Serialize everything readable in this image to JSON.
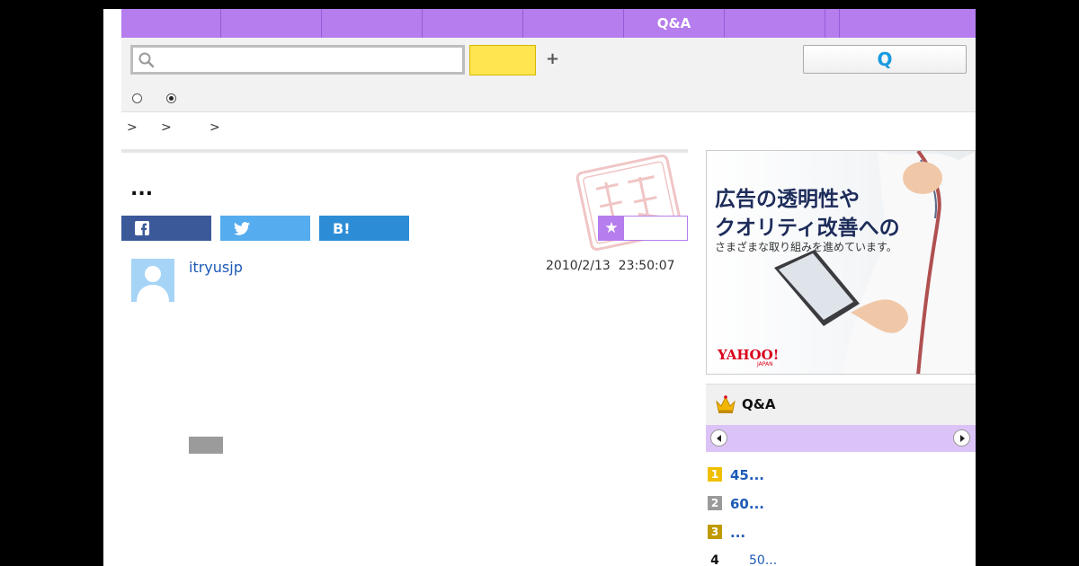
{
  "nav": {
    "items": [
      "",
      "",
      "",
      "",
      "",
      "Q&A",
      "",
      "",
      ""
    ]
  },
  "search": {
    "placeholder": "",
    "button_label": "",
    "plus_label": "+",
    "q_button_label": "Q"
  },
  "breadcrumb": {
    "separators": [
      ">",
      ">",
      ">"
    ]
  },
  "question": {
    "title": "...",
    "user": "itryusjp",
    "timestamp": "2010/2/13  23:50:07"
  },
  "share": {
    "hatena_label": "B!"
  },
  "ad": {
    "line1": "広告の透明性や",
    "line2": "クオリティ改善への",
    "line3": "さまざまな取り組みを進めています。",
    "logo": "YAHOO!",
    "logo_sub": "JAPAN"
  },
  "ranking": {
    "title": "Q&A",
    "items": [
      {
        "rank": "1",
        "text": "45...",
        "color": "#f0c000"
      },
      {
        "rank": "2",
        "text": "60...",
        "color": "#9a9a9a"
      },
      {
        "rank": "3",
        "text": "...",
        "color": "#c09a00"
      },
      {
        "rank": "4",
        "text": "50...",
        "color": ""
      }
    ]
  },
  "colors": {
    "nav": "#b57ded",
    "search_button": "#ffe550",
    "facebook": "#3b5998",
    "twitter": "#55acee",
    "hatena": "#2c8dd6",
    "link": "#1c5ab8"
  }
}
